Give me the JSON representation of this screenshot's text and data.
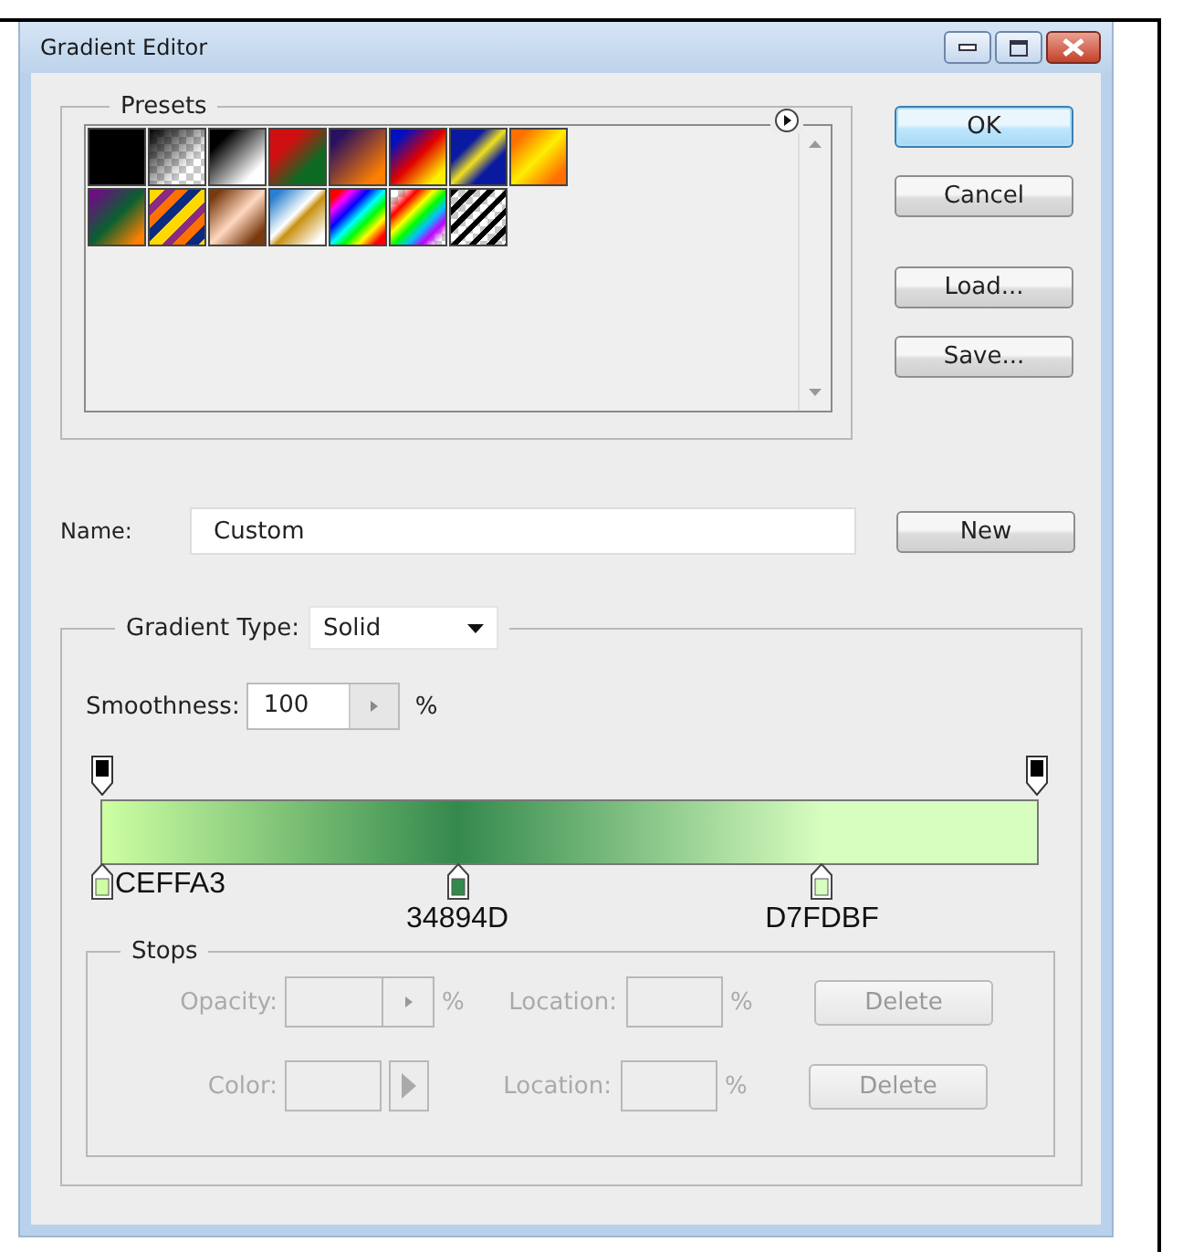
{
  "window": {
    "title": "Gradient Editor"
  },
  "presets": {
    "title": "Presets"
  },
  "buttons": [
    {
      "label": "OK",
      "default": true
    },
    {
      "label": "Cancel",
      "default": false
    },
    {
      "label": "Load...",
      "default": false
    },
    {
      "label": "Save...",
      "default": false
    }
  ],
  "name": {
    "label": "Name:",
    "value": "Custom",
    "button": "New"
  },
  "gradient_type": {
    "label": "Gradient Type:",
    "value": "Solid"
  },
  "smoothness": {
    "label": "Smoothness:",
    "value": "100",
    "unit": "%"
  },
  "opacity_stops": [
    {
      "level": 0
    },
    {
      "level": 1
    }
  ],
  "color_stops": [
    {
      "label": "CEFFA3",
      "color": "#ceffa3",
      "level": 0
    },
    {
      "label": "34894D",
      "color": "#34894d",
      "level": 0.38
    },
    {
      "label": "D7FDBF",
      "color": "#d7fdbf",
      "level": 0.77
    }
  ],
  "stops": {
    "title": "Stops",
    "rows": [
      {
        "kind": "opacity",
        "label": "Opacity:",
        "unit": "%",
        "location_label": "Location:",
        "location_unit": "%",
        "button": "Delete",
        "disabled": true
      },
      {
        "kind": "color",
        "label": "Color:",
        "location_label": "Location:",
        "location_unit": "%",
        "button": "Delete",
        "disabled": true
      }
    ]
  }
}
